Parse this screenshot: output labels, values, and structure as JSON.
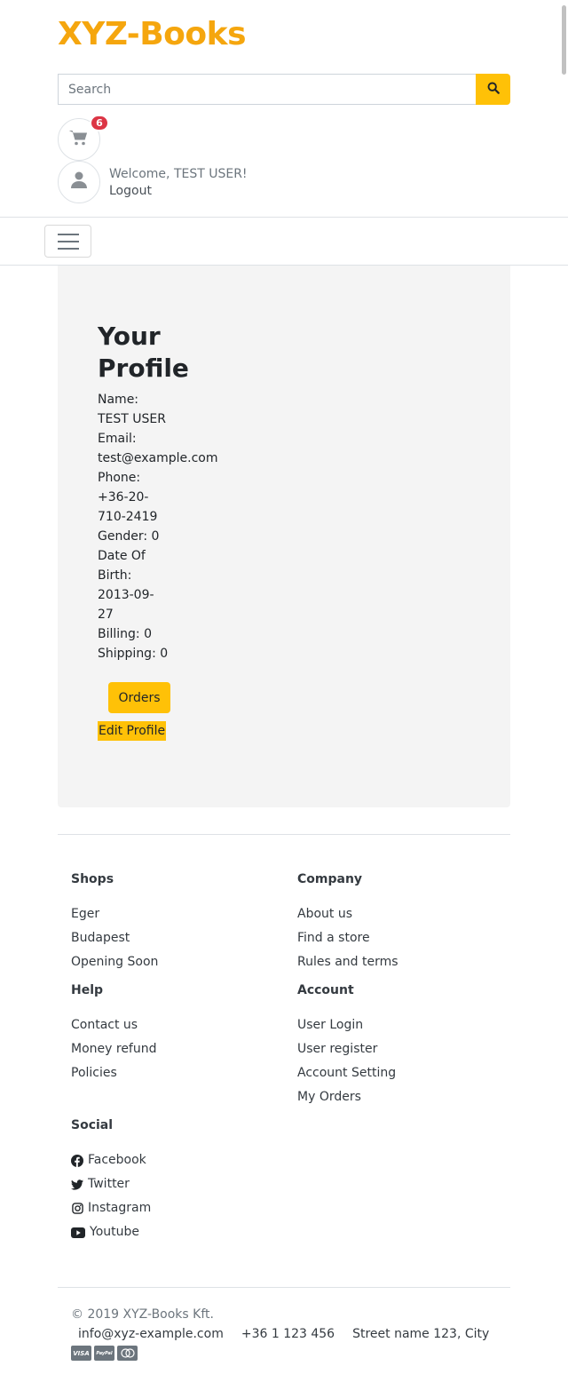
{
  "header": {
    "brand": "XYZ-Books",
    "search_placeholder": "Search",
    "cart_count": "6",
    "welcome_text": "Welcome, TEST USER!",
    "logout_label": "Logout"
  },
  "profile": {
    "title": "Your Profile",
    "name_label": "Name:",
    "name_value": "TEST USER",
    "email_label": "Email:",
    "email_value": "test@example.com",
    "phone_label": "Phone:",
    "phone_value": "+36-20-710-2419",
    "gender_label": "Gender:",
    "gender_value": "0",
    "dob_label": "Date Of Birth:",
    "dob_value": "2013-09-27",
    "billing_label": "Billing:",
    "billing_value": "0",
    "shipping_label": "Shipping:",
    "shipping_value": "0",
    "orders_label": "Orders",
    "edit_label": "Edit Profile"
  },
  "footer": {
    "shops": {
      "title": "Shops",
      "items": [
        "Eger",
        "Budapest",
        "Opening Soon"
      ]
    },
    "company": {
      "title": "Company",
      "items": [
        "About us",
        "Find a store",
        "Rules and terms"
      ]
    },
    "help": {
      "title": "Help",
      "items": [
        "Contact us",
        "Money refund",
        "Policies"
      ]
    },
    "account": {
      "title": "Account",
      "items": [
        "User Login",
        "User register",
        "Account Setting",
        "My Orders"
      ]
    },
    "social": {
      "title": "Social",
      "items": [
        "Facebook",
        "Twitter",
        "Instagram",
        "Youtube"
      ]
    },
    "copyright": "© 2019 XYZ-Books Kft.",
    "email": "info@xyz-example.com",
    "phone": "+36 1 123 456",
    "address": "Street name 123, City",
    "payments": [
      "VISA",
      "PayPal",
      "mastercard"
    ]
  },
  "colors": {
    "accent": "#ffc107",
    "brand": "#f5a60e",
    "badge": "#dc3545"
  }
}
